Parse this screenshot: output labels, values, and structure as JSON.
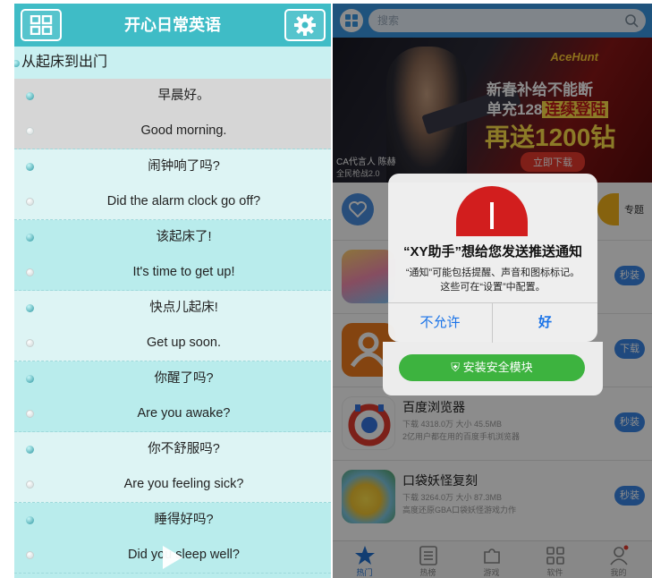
{
  "left_app": {
    "title": "开心日常英语",
    "section_title": "从起床到出门",
    "phrases": [
      {
        "cn": "早晨好。",
        "en": "Good morning."
      },
      {
        "cn": "闹钟响了吗?",
        "en": "Did the alarm clock go off?"
      },
      {
        "cn": "该起床了!",
        "en": "It's time to get up!"
      },
      {
        "cn": "快点儿起床!",
        "en": "Get up soon."
      },
      {
        "cn": "你醒了吗?",
        "en": "Are you awake?"
      },
      {
        "cn": "你不舒服吗?",
        "en": "Are you feeling sick?"
      },
      {
        "cn": "睡得好吗?",
        "en": "Did you sleep well?"
      }
    ],
    "selected_index": 0,
    "colors": {
      "header": "#3fbcc6",
      "background": "#b9ecec",
      "selected_row": "#d6d6d6"
    }
  },
  "right_app": {
    "search_placeholder": "搜索",
    "banner": {
      "logo_text": "AceHunt",
      "line1": "新春补给不能断",
      "line2_prefix": "单充128",
      "line2_highlight": "连续登陆",
      "line3": "再送1200钻",
      "download": "立即下载",
      "caption1": "CA代言人 陈赫",
      "caption2": "全民枪战2.0"
    },
    "category_label": "专题",
    "apps": [
      {
        "name": "",
        "meta": "",
        "desc": "",
        "button": "秒装"
      },
      {
        "name": "",
        "meta": "",
        "desc": "",
        "button": "下载"
      },
      {
        "name": "百度浏览器",
        "meta": "下载 4318.0万  大小 45.5MB",
        "desc": "2亿用户都在用的百度手机浏览器",
        "button": "秒装"
      },
      {
        "name": "口袋妖怪复刻",
        "meta": "下载 3264.0万  大小 87.3MB",
        "desc": "高度还原GBA口袋妖怪游戏力作",
        "button": "秒装"
      }
    ],
    "install_security": "安装安全模块",
    "tabs": [
      {
        "label": "热门",
        "icon": "star-icon",
        "active": true
      },
      {
        "label": "热榜",
        "icon": "list-icon",
        "active": false
      },
      {
        "label": "游戏",
        "icon": "puzzle-icon",
        "active": false
      },
      {
        "label": "软件",
        "icon": "grid-icon",
        "active": false
      },
      {
        "label": "我的",
        "icon": "user-icon",
        "active": false
      }
    ],
    "alert": {
      "title": "“XY助手”想给您发送推送通知",
      "message_line1": "“通知”可能包括提醒、声音和图标标记。",
      "message_line2": "这些可在“设置”中配置。",
      "deny": "不允许",
      "allow": "好"
    },
    "colors": {
      "accent": "#3a98e3",
      "button": "#3a86e6",
      "green": "#3db33f",
      "alert_link": "#1a73e8"
    }
  }
}
